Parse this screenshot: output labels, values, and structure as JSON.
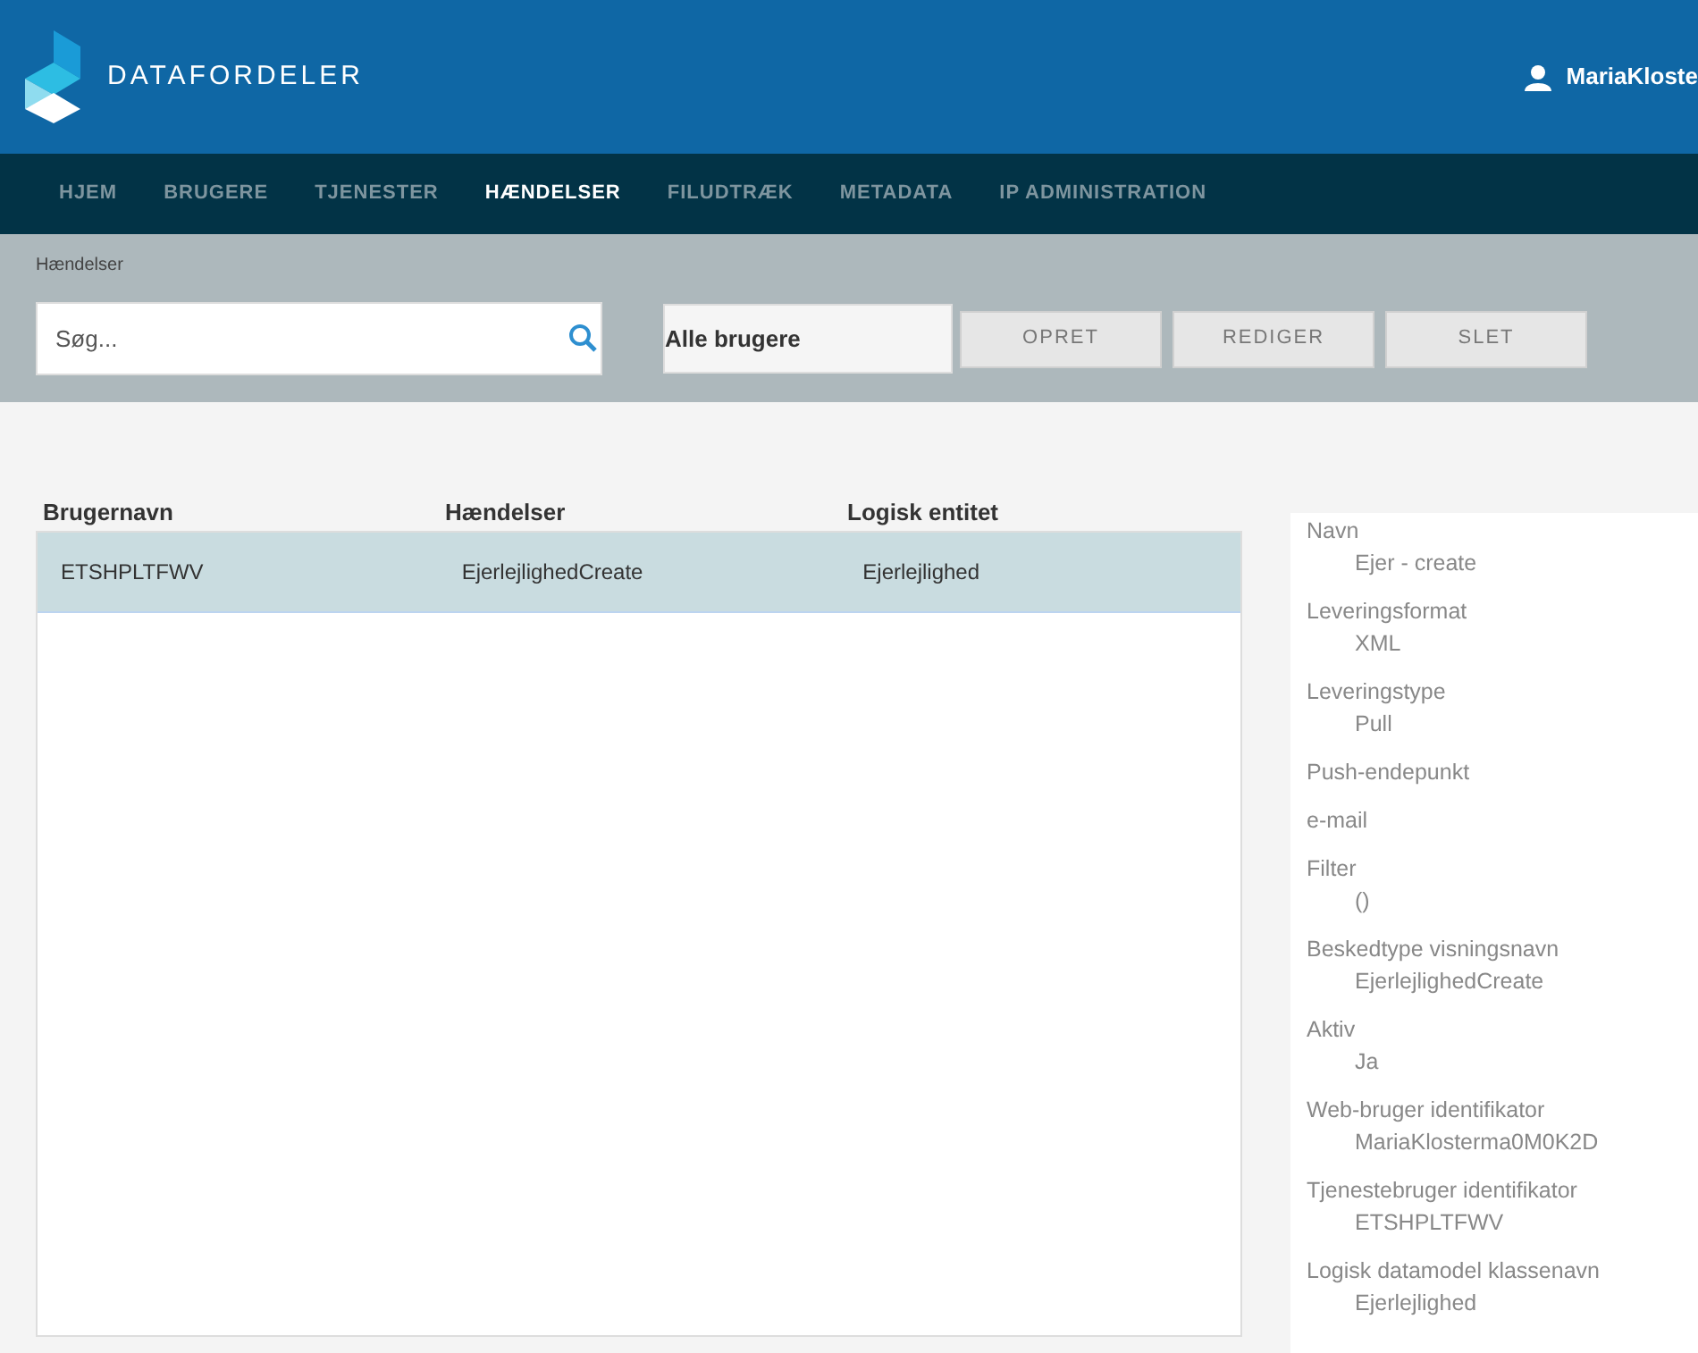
{
  "header": {
    "logo_text": "DATAFORDELER",
    "user": "MariaKloste"
  },
  "nav": [
    {
      "label": "HJEM",
      "selected": false
    },
    {
      "label": "BRUGERE",
      "selected": false
    },
    {
      "label": "TJENESTER",
      "selected": false
    },
    {
      "label": "HÆNDELSER",
      "selected": true
    },
    {
      "label": "FILUDTRÆK",
      "selected": false
    },
    {
      "label": "METADATA",
      "selected": false
    },
    {
      "label": "IP ADMINISTRATION",
      "selected": false
    }
  ],
  "breadcrumb": "Hændelser",
  "search": {
    "placeholder": "Søg..."
  },
  "user_filter": {
    "value": "Alle brugere"
  },
  "buttons": [
    "OPRET",
    "REDIGER",
    "SLET"
  ],
  "table": {
    "columns": [
      "Brugernavn",
      "Hændelser",
      "Logisk entitet"
    ],
    "rows": [
      {
        "cells": [
          "ETSHPLTFWV",
          "EjerlejlighedCreate",
          "Ejerlejlighed"
        ],
        "selected": true
      }
    ]
  },
  "details": [
    {
      "label": "Navn",
      "value": "Ejer - create"
    },
    {
      "label": "Leveringsformat",
      "value": "XML"
    },
    {
      "label": "Leveringstype",
      "value": "Pull"
    },
    {
      "label": "Push-endepunkt"
    },
    {
      "label": "e-mail"
    },
    {
      "label": "Filter",
      "value": "()"
    },
    {
      "label": "Beskedtype visningsnavn",
      "value": "EjerlejlighedCreate"
    },
    {
      "label": "Aktiv",
      "value": "Ja"
    },
    {
      "label": "Web-bruger identifikator",
      "value": "MariaKlosterma0M0K2D"
    },
    {
      "label": "Tjenestebruger identifikator",
      "value": "ETSHPLTFWV"
    },
    {
      "label": "Logisk datamodel klassenavn",
      "value": "Ejerlejlighed"
    }
  ]
}
